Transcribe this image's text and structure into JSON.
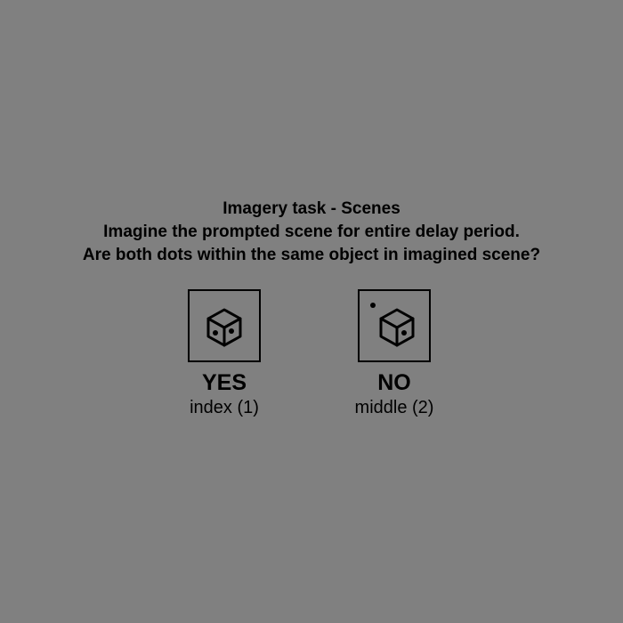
{
  "instructions": {
    "title": "Imagery task - Scenes",
    "line1": "Imagine the prompted scene for entire delay period.",
    "line2": "Are both dots within the same object in imagined scene?"
  },
  "options": [
    {
      "label": "YES",
      "key_hint": "index (1)",
      "icon": "cube-two-dots-same-object-icon"
    },
    {
      "label": "NO",
      "key_hint": "middle (2)",
      "icon": "cube-dot-outside-object-icon"
    }
  ],
  "colors": {
    "background": "#808080",
    "foreground": "#000000"
  }
}
